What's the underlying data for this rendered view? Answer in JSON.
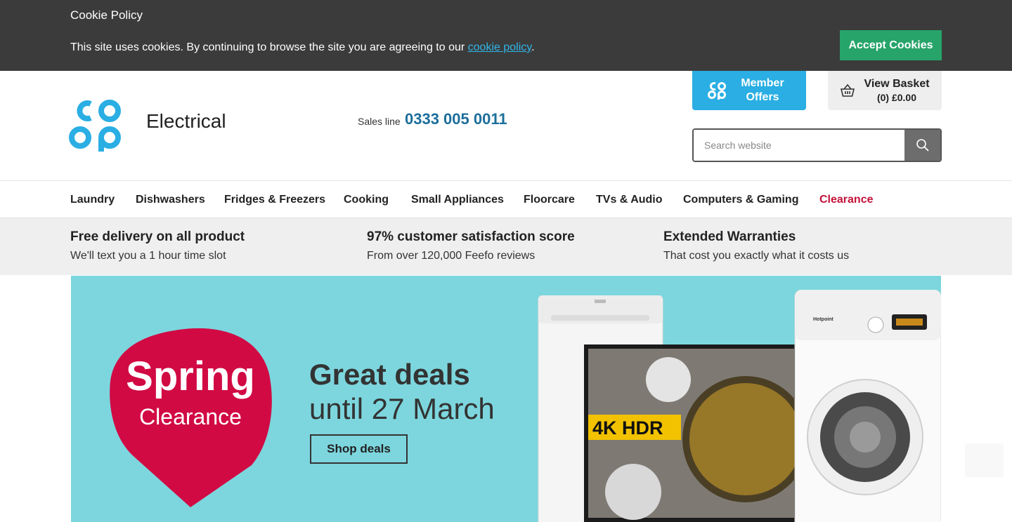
{
  "cookie": {
    "title": "Cookie Policy",
    "text_before": "This site uses cookies. By continuing to browse the site you are agreeing to our ",
    "link": "cookie policy",
    "text_after": ".",
    "accept_label": "Accept Cookies"
  },
  "header": {
    "brand_sub": "Electrical",
    "sales_label": "Sales line",
    "sales_phone": "0333 005 0011",
    "member_offers": "Member Offers",
    "basket_title": "View Basket",
    "basket_count": "(0) £0.00",
    "search_placeholder": "Search website"
  },
  "nav": {
    "items": [
      "Laundry",
      "Dishwashers",
      "Fridges & Freezers",
      "Cooking",
      "Small Appliances",
      "Floorcare",
      "TVs & Audio",
      "Computers & Gaming",
      "Clearance"
    ]
  },
  "usps": [
    {
      "title": "Free delivery on all product",
      "sub": "We'll text you a 1 hour time slot"
    },
    {
      "title": "97% customer satisfaction score",
      "sub": "From over 120,000 Feefo reviews"
    },
    {
      "title": "Extended Warranties",
      "sub": "That cost you exactly what it costs us"
    }
  ],
  "hero": {
    "badge_title": "Spring",
    "badge_sub": "Clearance",
    "deals_title": "Great deals",
    "deals_sub": "until 27 March",
    "shop_label": "Shop deals",
    "tv_badge": "4K HDR",
    "washer_brand": "Hotpoint"
  },
  "colors": {
    "cookie_bg": "#3b3b3b",
    "accept": "#27a46a",
    "coop_blue": "#2aaee3",
    "phone": "#1c6e9b",
    "clearance": "#c4123a",
    "hero_bg": "#7dd6de",
    "badge": "#d10a44"
  }
}
